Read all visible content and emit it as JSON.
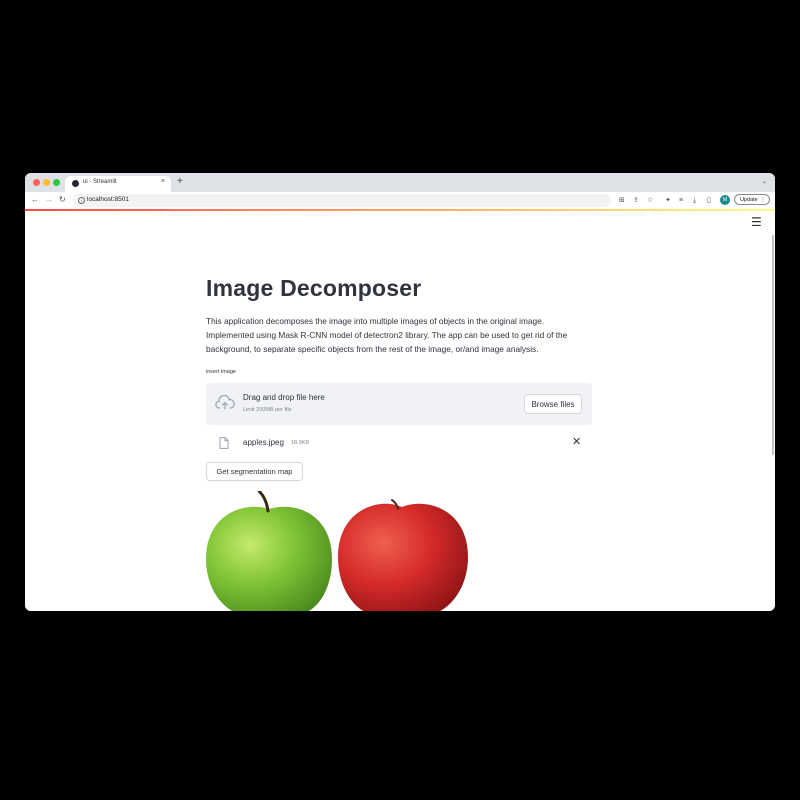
{
  "browser": {
    "tab_title": "ui · Streamlit",
    "tab_close": "×",
    "new_tab": "+",
    "tab_menu": "⌄",
    "url": "localhost:8501",
    "back": "←",
    "forward": "→",
    "reload": "↻",
    "profile_initial": "M",
    "update_label": "Update",
    "update_menu": "⋮"
  },
  "app": {
    "menu_icon": "☰",
    "title": "Image Decomposer",
    "description": "This application decomposes the image into multiple images of objects in the original image. Implemented using Mask R-CNN model of detectron2 library. The app can be used to get rid of the background, to separate specific objects from the rest of the image, or/and image analysis.",
    "uploader": {
      "label": "insert image",
      "drop_title": "Drag and drop file here",
      "limit": "Limit 200MB per file",
      "browse_label": "Browse files"
    },
    "file": {
      "name": "apples.jpeg",
      "size": "18.3KB",
      "remove": "✕"
    },
    "segment_button": "Get segmentation map"
  },
  "colors": {
    "streamlit_red": "#ff4b4b",
    "text": "#31333f",
    "dropzone_bg": "#f0f2f6",
    "green_apple": "#7cc234",
    "red_apple": "#d42a2a"
  }
}
